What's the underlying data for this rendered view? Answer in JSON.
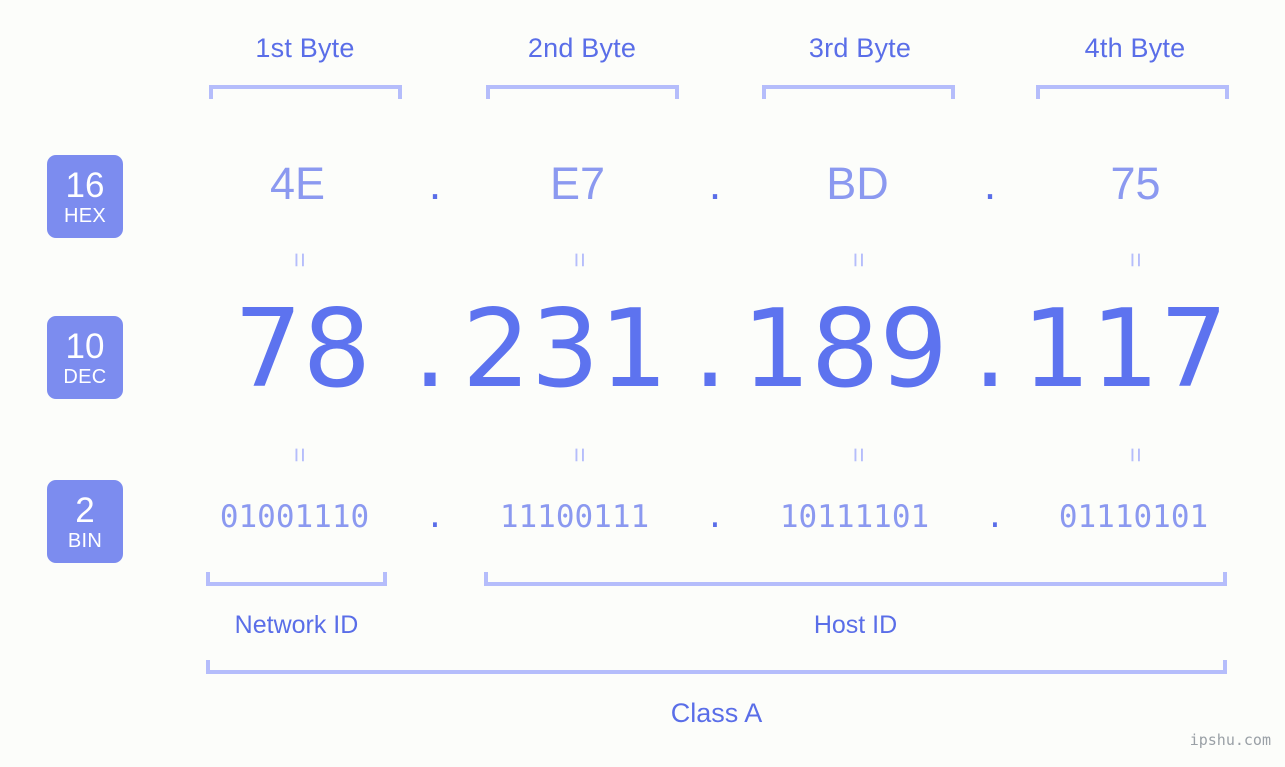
{
  "background_color": "#fcfdfa",
  "accent_color": "#5a6ee8",
  "accent_light_color": "#8b99f0",
  "bracket_color": "#b5bdfb",
  "badge_color": "#7c8cef",
  "headers": [
    {
      "label": "1st Byte"
    },
    {
      "label": "2nd Byte"
    },
    {
      "label": "3rd Byte"
    },
    {
      "label": "4th Byte"
    }
  ],
  "bases": [
    {
      "number": "16",
      "name": "HEX"
    },
    {
      "number": "10",
      "name": "DEC"
    },
    {
      "number": "2",
      "name": "BIN"
    }
  ],
  "separator": ".",
  "equals_mark": "=",
  "rows": {
    "hex": {
      "values": [
        "4E",
        "E7",
        "BD",
        "75"
      ]
    },
    "dec": {
      "values": [
        "78",
        "231",
        "189",
        "117"
      ]
    },
    "bin": {
      "values": [
        "01001110",
        "11100111",
        "10111101",
        "01110101"
      ]
    }
  },
  "footer": {
    "network_id_label": "Network ID",
    "host_id_label": "Host ID",
    "class_label": "Class A"
  },
  "watermark": "ipshu.com"
}
